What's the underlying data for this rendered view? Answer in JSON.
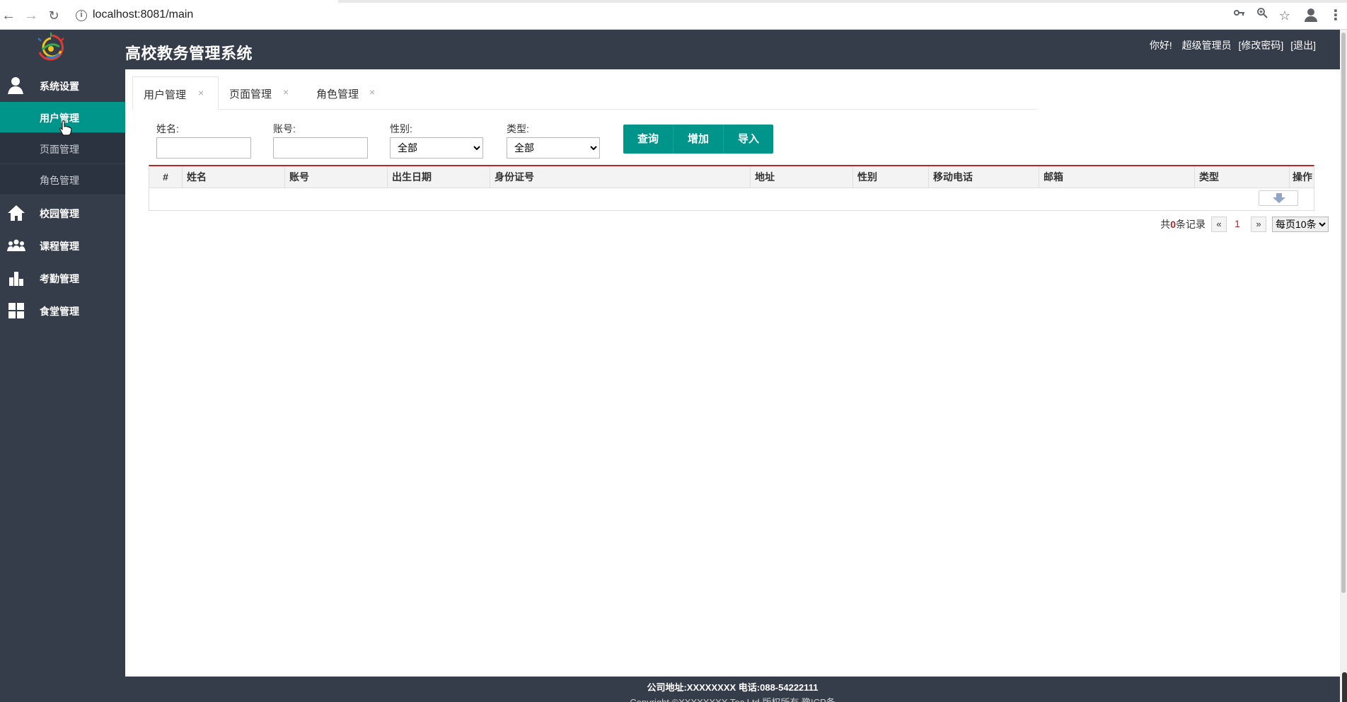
{
  "browser": {
    "url": "localhost:8081/main"
  },
  "header": {
    "title": "高校教务管理系统",
    "greeting": "你好!",
    "user": "超级管理员",
    "change_password": "[修改密码]",
    "logout": "[退出]"
  },
  "sidebar": {
    "groups": [
      {
        "label": "系统设置",
        "icon": "user-icon"
      },
      {
        "label": "校园管理",
        "icon": "home-icon"
      },
      {
        "label": "课程管理",
        "icon": "group-icon"
      },
      {
        "label": "考勤管理",
        "icon": "bar-chart-icon"
      },
      {
        "label": "食堂管理",
        "icon": "grid-icon"
      }
    ],
    "submenu": [
      {
        "label": "用户管理",
        "active": true
      },
      {
        "label": "页面管理",
        "active": false
      },
      {
        "label": "角色管理",
        "active": false
      }
    ]
  },
  "tabs": [
    {
      "label": "用户管理",
      "close": "×"
    },
    {
      "label": "页面管理",
      "close": "×"
    },
    {
      "label": "角色管理",
      "close": "×"
    }
  ],
  "filters": {
    "name_label": "姓名:",
    "name_value": "",
    "account_label": "账号:",
    "account_value": "",
    "gender_label": "性别:",
    "gender_value": "全部",
    "type_label": "类型:",
    "type_value": "全部"
  },
  "buttons": {
    "query": "查询",
    "add": "增加",
    "import": "导入"
  },
  "table": {
    "columns": [
      "#",
      "姓名",
      "账号",
      "出生日期",
      "身份证号",
      "地址",
      "性别",
      "移动电话",
      "邮箱",
      "类型",
      "操作"
    ],
    "rows": []
  },
  "pager": {
    "count_prefix": "共",
    "count_value": "0",
    "count_suffix": "条记录",
    "prev": "«",
    "page": "1",
    "next": "»",
    "page_size": "每页10条"
  },
  "footer": {
    "address": "公司地址:XXXXXXXX 电话:088-54222111",
    "line2": "Copyright ©XXXXXXXX Tec Ltd 版权所有 豫ICP备"
  },
  "colors": {
    "sidebar_bg": "#363d4a",
    "accent": "#00958a",
    "table_top_border": "#b3262c"
  }
}
